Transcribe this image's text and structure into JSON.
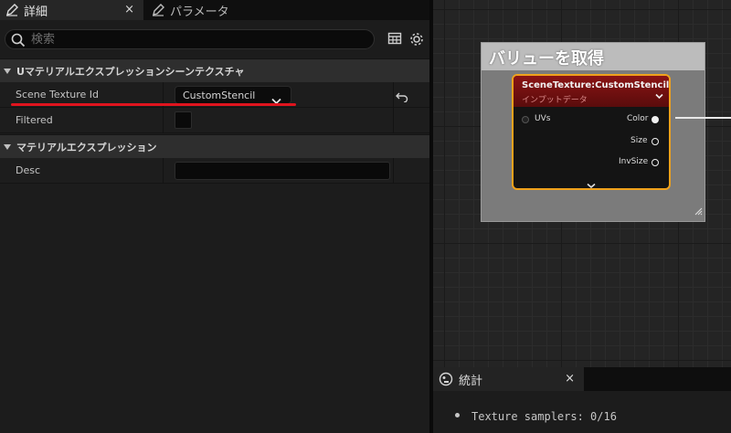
{
  "tabs": {
    "details_label": "詳細",
    "params_label": "パラメータ",
    "close": "×"
  },
  "search": {
    "placeholder": "検索"
  },
  "sections": [
    {
      "label": "Uマテリアルエクスプレッションシーンテクスチャ"
    },
    {
      "label": "マテリアルエクスプレッション"
    }
  ],
  "properties": {
    "scene_texture_id": {
      "label": "Scene Texture Id",
      "value": "CustomStencil"
    },
    "filtered": {
      "label": "Filtered",
      "checked": false
    },
    "desc": {
      "label": "Desc",
      "value": ""
    }
  },
  "graph": {
    "comment_title": "バリューを取得",
    "node": {
      "title": "SceneTexture:CustomStencil",
      "subtitle": "インプットデータ",
      "inputs": [
        "UVs"
      ],
      "outputs": [
        "Color",
        "Size",
        "InvSize"
      ]
    }
  },
  "stats": {
    "tab_label": "統計",
    "close": "×",
    "line": "Texture samplers: 0/16"
  },
  "colors": {
    "node_border": "#f0a21c",
    "node_header": "#8a1414",
    "highlight_underline": "#e0141e"
  }
}
